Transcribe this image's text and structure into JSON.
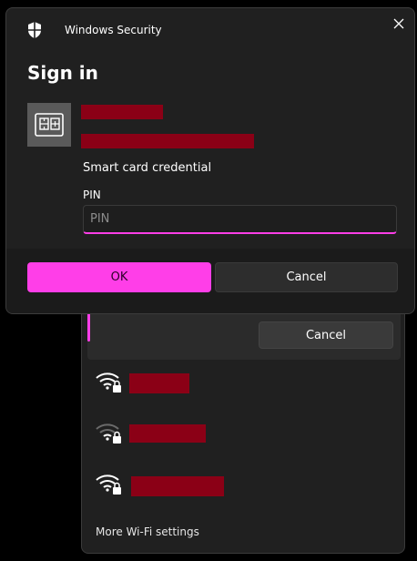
{
  "dialog": {
    "window_title": "Windows Security",
    "heading": "Sign in",
    "credential_label": "Smart card credential",
    "pin_label": "PIN",
    "pin_placeholder": "PIN",
    "ok_label": "OK",
    "cancel_label": "Cancel",
    "icons": {
      "title": "shield-icon",
      "close": "close-icon",
      "card": "smart-card-icon"
    }
  },
  "wifi_flyout": {
    "cancel_label": "Cancel",
    "networks": [
      {
        "signal": "full",
        "secured": true
      },
      {
        "signal": "weak",
        "secured": true
      },
      {
        "signal": "full",
        "secured": true
      }
    ],
    "footer_link": "More Wi-Fi settings"
  },
  "colors": {
    "accent": "#ff3ee8",
    "redaction": "#8b0016",
    "surface": "#202020"
  }
}
